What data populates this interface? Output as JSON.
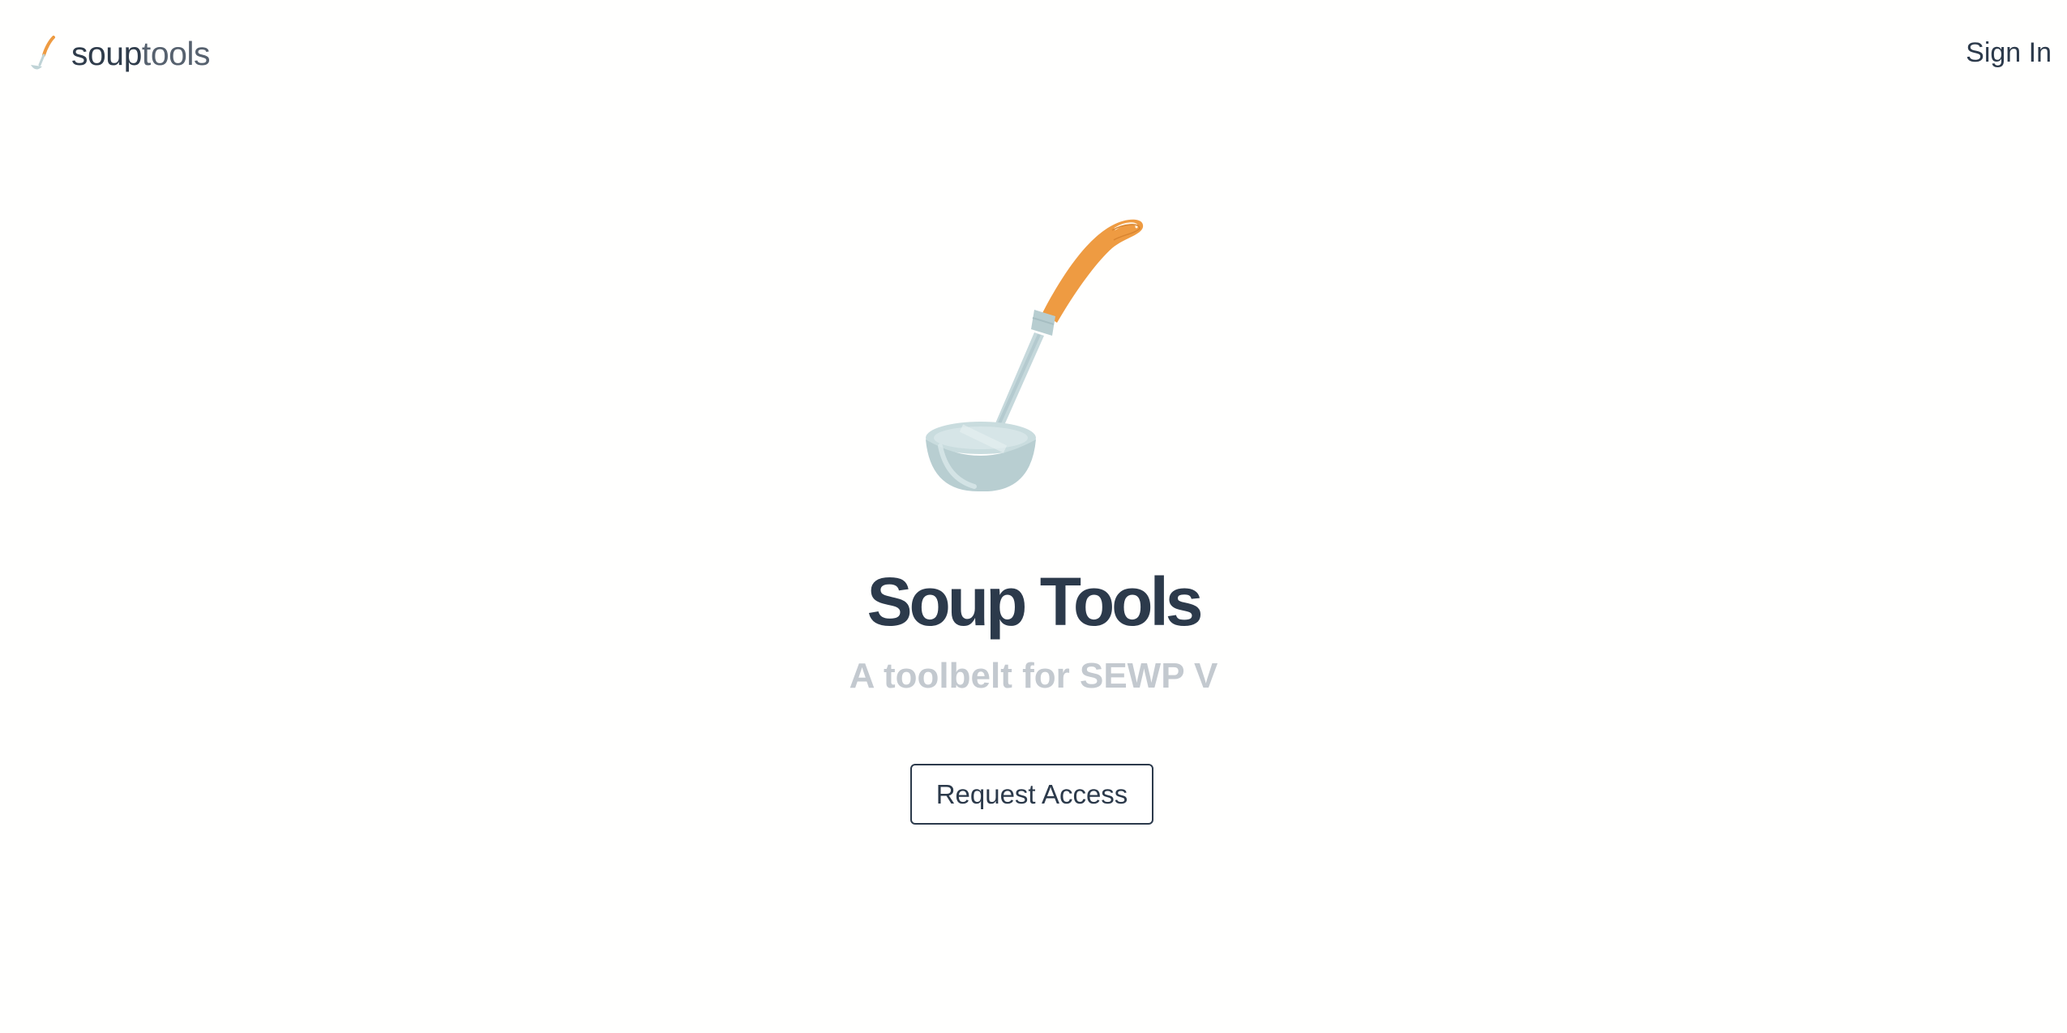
{
  "header": {
    "brand_strong": "soup",
    "brand_light": "tools",
    "signin_label": "Sign In"
  },
  "hero": {
    "illustration_icon": "ladle-icon",
    "title": "Soup Tools",
    "subtitle": "A toolbelt for SEWP V",
    "cta_label": "Request Access"
  },
  "colors": {
    "text_dark": "#2c3a4b",
    "text_muted": "#c3c9cf",
    "ladle_handle": "#ee9b42",
    "ladle_metal": "#bfd3d6",
    "background": "#fffffe"
  }
}
